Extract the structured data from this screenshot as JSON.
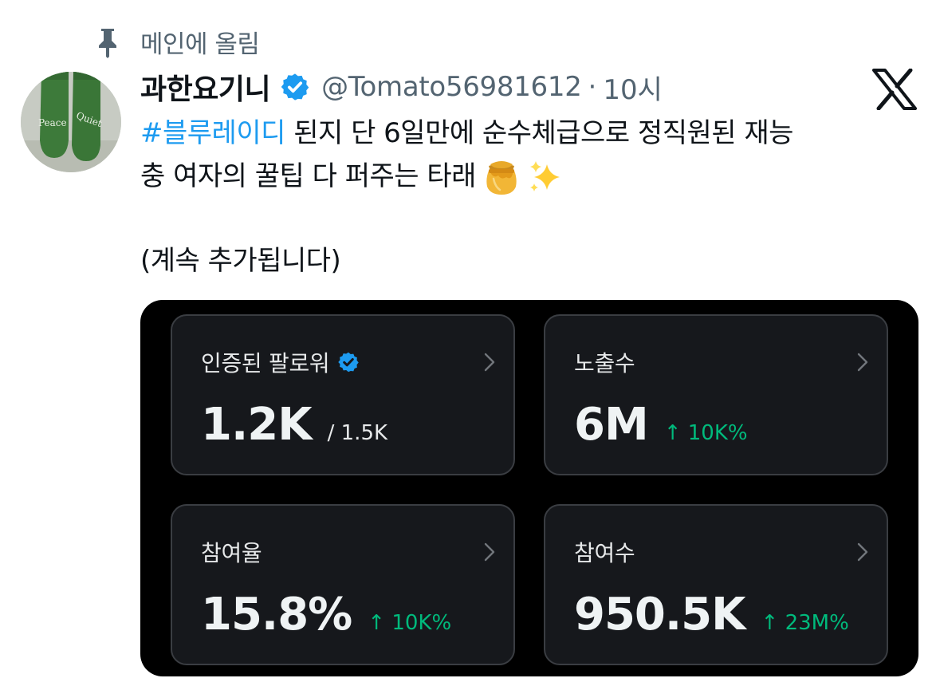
{
  "pinned": {
    "label": "메인에 올림",
    "icon": "pin-icon"
  },
  "author": {
    "display_name": "과한요기니",
    "handle": "@Tomato56981612",
    "separator": "·",
    "time": "10시",
    "verified": true,
    "avatar_text_left": "Peace",
    "avatar_text_right": "Quiet"
  },
  "tweet": {
    "hashtag": "#블루레이디",
    "line1_rest": " 된지 단 6일만에 순수체급으로 정직원된 재능",
    "line2": "충 여자의 꿀팁 다 퍼주는 타래",
    "emojis": [
      "honey-pot-icon",
      "sparkles-icon"
    ],
    "line3": "(계속 추가됩니다)"
  },
  "stats": [
    {
      "label": "인증된 팔로워",
      "value": "1.2K",
      "sub": "/ 1.5K",
      "change": "",
      "verified": true
    },
    {
      "label": "노출수",
      "value": "6M",
      "sub": "",
      "change": "↑ 10K%",
      "verified": false
    },
    {
      "label": "참여율",
      "value": "15.8%",
      "sub": "",
      "change": "↑ 10K%",
      "verified": false
    },
    {
      "label": "참여수",
      "value": "950.5K",
      "sub": "",
      "change": "↑ 23M%",
      "verified": false
    }
  ],
  "colors": {
    "link": "#1d9bf0",
    "secondary_text": "#536471",
    "positive": "#00ba7c",
    "card_bg": "#16181c",
    "media_bg": "#000000"
  }
}
